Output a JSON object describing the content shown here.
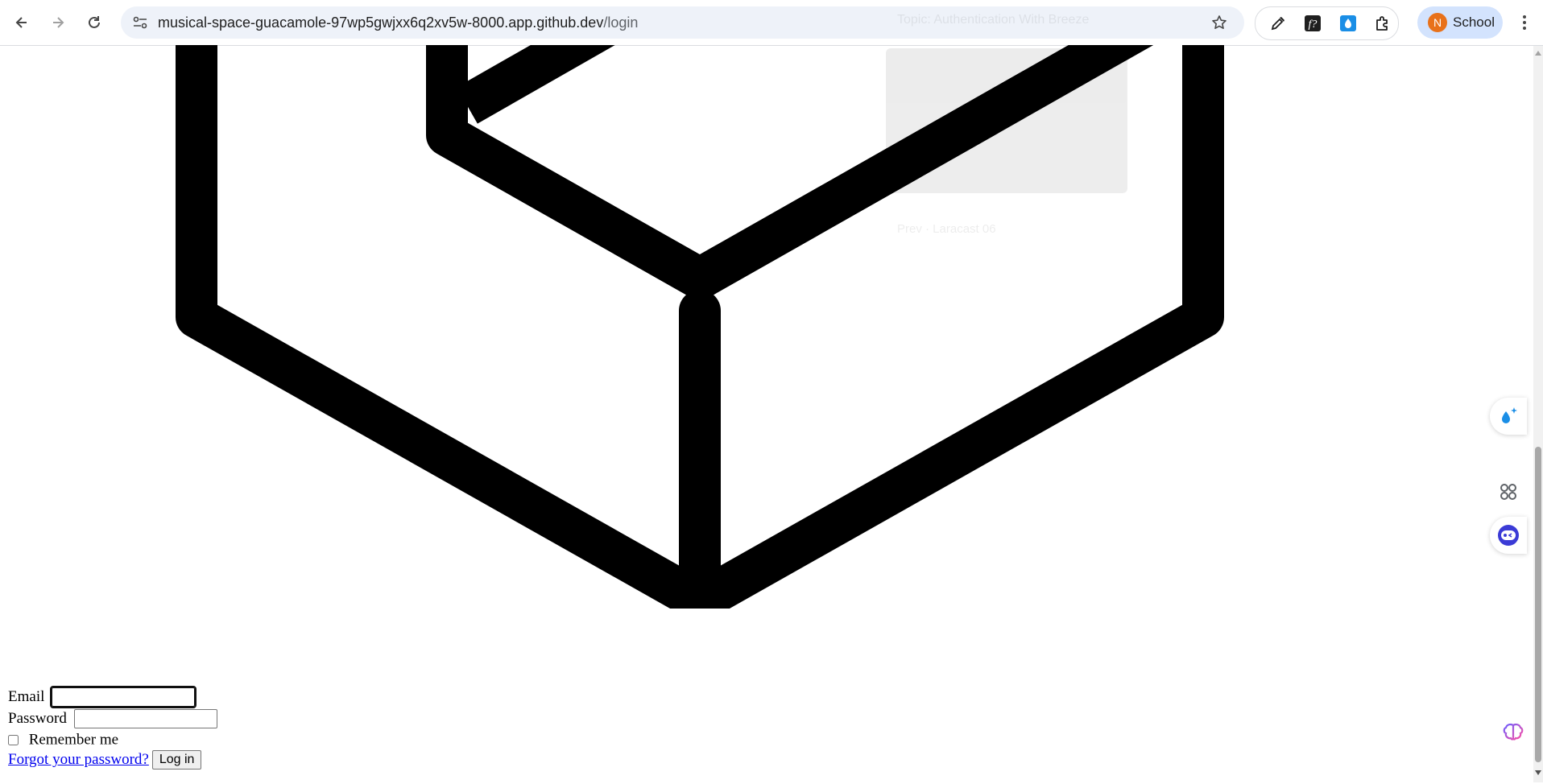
{
  "browser": {
    "url_host": "musical-space-guacamole-97wp5gwjxx6q2xv5w-8000.app.github.dev",
    "url_path": "/login",
    "profile_initial": "N",
    "profile_label": "School",
    "icons": {
      "back": "back-arrow-icon",
      "forward": "forward-arrow-icon",
      "reload": "reload-icon",
      "site_info": "site-info-icon",
      "bookmark": "star-icon",
      "extensions": [
        "eyedropper-icon",
        "font-function-icon",
        "water-drop-icon",
        "puzzle-icon"
      ],
      "menu": "three-dots-icon"
    }
  },
  "ghost_overlay": {
    "title": "Topic: Authentication With Breeze",
    "footer": "Prev · Laracast 06"
  },
  "login_form": {
    "email_label": "Email",
    "email_value": "",
    "password_label": "Password",
    "password_value": "",
    "remember_label": "Remember me",
    "remember_checked": false,
    "forgot_link": "Forgot your password?",
    "submit_label": "Log in"
  },
  "side_widgets": [
    "sparkle-drop-icon",
    "command-icon",
    "face-icon",
    "brain-icon"
  ],
  "colors": {
    "omnibox_bg": "#eef2f9",
    "profile_chip_bg": "#d3e3fd",
    "avatar_bg": "#e8711a",
    "link": "#0000ee",
    "logo_stroke": "#000000"
  }
}
